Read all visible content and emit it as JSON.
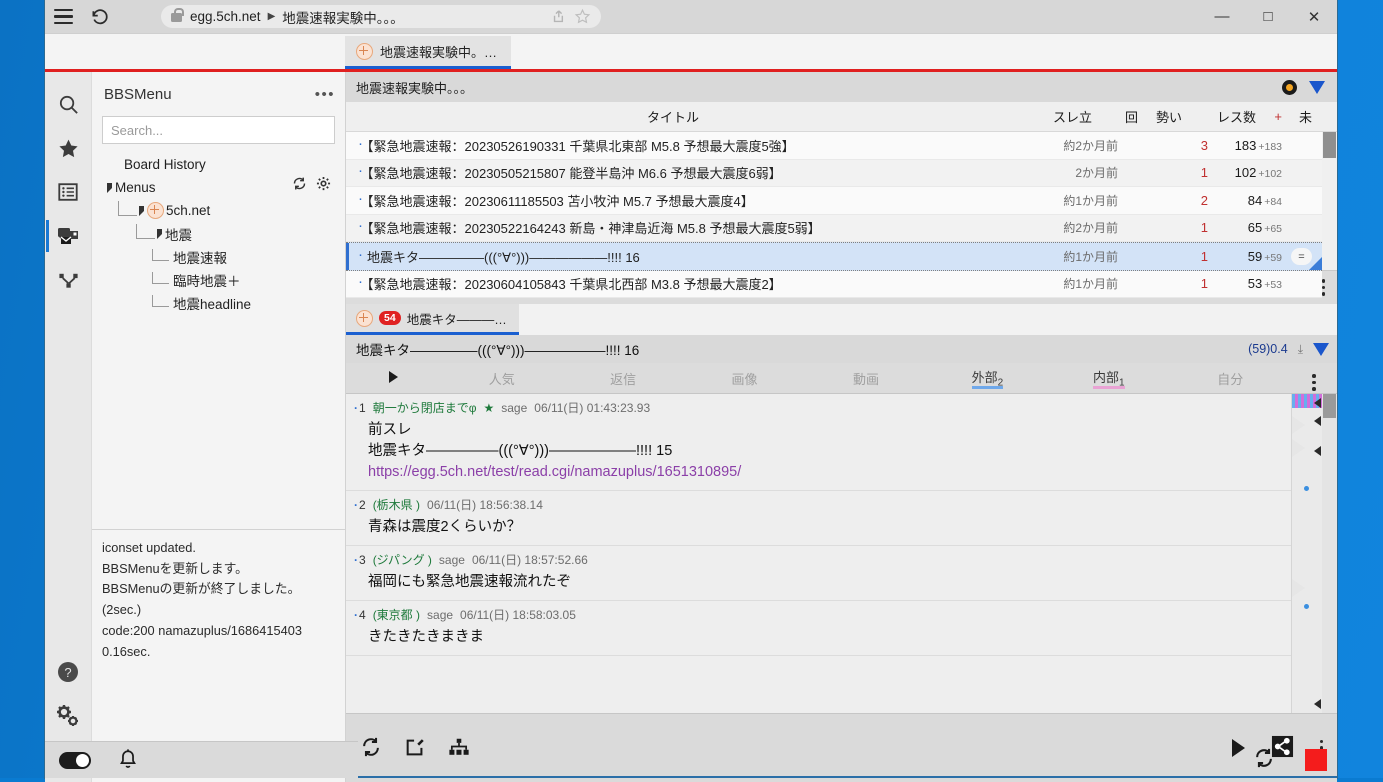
{
  "browser": {
    "url_host": "egg.5ch.net",
    "url_separator": "▶",
    "page_title": "地震速報実験中。。。",
    "minimize": "—",
    "maximize": "□",
    "close": "✕",
    "tab_label": "地震速報実験中。…"
  },
  "rail": {
    "items": [
      {
        "name": "search-icon",
        "label": "Search"
      },
      {
        "name": "favorites-icon",
        "label": "Favorites"
      },
      {
        "name": "board-list-icon",
        "label": "Board list"
      },
      {
        "name": "threads-icon",
        "label": "Threads"
      },
      {
        "name": "share-tree-icon",
        "label": "Tree"
      }
    ],
    "help": "?",
    "settings": "gears"
  },
  "leftpanel": {
    "title": "BBSMenu",
    "menu_dots": "•••",
    "search_placeholder": "Search...",
    "tree": [
      {
        "label": "Board History",
        "depth": 0,
        "kind": "plain"
      },
      {
        "label": "Menus",
        "depth": 0,
        "kind": "expanded"
      },
      {
        "label": "5ch.net",
        "depth": 1,
        "kind": "expanded-icon"
      },
      {
        "label": "地震",
        "depth": 2,
        "kind": "expanded"
      },
      {
        "label": "地震速報",
        "depth": 3,
        "kind": "leaf"
      },
      {
        "label": "臨時地震＋",
        "depth": 3,
        "kind": "leaf"
      },
      {
        "label": "地震headline",
        "depth": 3,
        "kind": "leaf"
      }
    ],
    "log_lines": [
      "iconset updated.",
      "BBSMenuを更新します。",
      "BBSMenuの更新が終了しました。(2sec.)",
      "code:200 namazuplus/1686415403",
      "0.16sec."
    ]
  },
  "board": {
    "header_title": "地震速報実験中。。。",
    "columns": {
      "title": "タイトル",
      "created": "スレ立",
      "count": "回",
      "momentum": "勢い",
      "responses": "レス数",
      "plus": "+",
      "unread": "未"
    },
    "rows": [
      {
        "title": "【緊急地震速報：20230526190331 千葉県北東部 M5.8 予想最大震度5強】",
        "created": "約2か月前",
        "count": "3",
        "responses": "183",
        "plus": "+183",
        "selected": false,
        "badge": ""
      },
      {
        "title": "【緊急地震速報：20230505215807 能登半島沖 M6.6 予想最大震度6弱】",
        "created": "2か月前",
        "count": "1",
        "responses": "102",
        "plus": "+102",
        "selected": false,
        "badge": ""
      },
      {
        "title": "【緊急地震速報：20230611185503 苫小牧沖 M5.7 予想最大震度4】",
        "created": "約1か月前",
        "count": "2",
        "responses": "84",
        "plus": "+84",
        "selected": false,
        "badge": ""
      },
      {
        "title": "【緊急地震速報：20230522164243 新島・神津島近海 M5.8 予想最大震度5弱】",
        "created": "約2か月前",
        "count": "1",
        "responses": "65",
        "plus": "+65",
        "selected": false,
        "badge": ""
      },
      {
        "title": "地震キタ—————(((°∀°)))——————!!!! 16",
        "created": "約1か月前",
        "count": "1",
        "responses": "59",
        "plus": "+59",
        "selected": true,
        "badge": "="
      },
      {
        "title": "【緊急地震速報：20230604105843 千葉県北西部 M3.8 予想最大震度2】",
        "created": "約1か月前",
        "count": "1",
        "responses": "53",
        "plus": "+53",
        "selected": false,
        "badge": ""
      }
    ]
  },
  "thread_toolbar": {
    "reload": "reload-icon",
    "numbering": "numbered-list-icon",
    "sort": "sort-desc-icon",
    "more": "kebab-icon"
  },
  "thread": {
    "tab_badge": "54",
    "tab_label": "地震キタ———…",
    "title": "地震キタ—————(((°∀°)))——————!!!! 16",
    "count_rate": "(59)0.4",
    "filters": [
      {
        "label": "人気",
        "sub": "",
        "active": false,
        "underline": ""
      },
      {
        "label": "返信",
        "sub": "",
        "active": false,
        "underline": ""
      },
      {
        "label": "画像",
        "sub": "",
        "active": false,
        "underline": ""
      },
      {
        "label": "動画",
        "sub": "",
        "active": false,
        "underline": ""
      },
      {
        "label": "外部",
        "sub": "2",
        "active": true,
        "underline": "blue"
      },
      {
        "label": "内部",
        "sub": "1",
        "active": true,
        "underline": "pink"
      },
      {
        "label": "自分",
        "sub": "",
        "active": false,
        "underline": ""
      }
    ],
    "posts": [
      {
        "num": "1",
        "name": "朝一から閉店までφ",
        "star": "★",
        "sage": "sage",
        "time": "06/11(日) 01:43:23.93",
        "lines": [
          "前スレ",
          "地震キタ—————(((°∀°)))——————!!!! 15"
        ],
        "link": "https://egg.5ch.net/test/read.cgi/namazuplus/1651310895/"
      },
      {
        "num": "2",
        "name": "(栃木県 )",
        "star": "",
        "sage": "",
        "time": "06/11(日) 18:56:38.14",
        "lines": [
          "青森は震度2くらいか？"
        ],
        "link": ""
      },
      {
        "num": "3",
        "name": "(ジパング )",
        "star": "",
        "sage": "sage",
        "time": "06/11(日) 18:57:52.66",
        "lines": [
          "福岡にも緊急地震速報流れたぞ"
        ],
        "link": ""
      },
      {
        "num": "4",
        "name": "(東京都 )",
        "star": "",
        "sage": "sage",
        "time": "06/11(日) 18:58:03.05",
        "lines": [
          "きたきたきまきま"
        ],
        "link": ""
      }
    ]
  },
  "bottombar": {
    "reload": "reload-icon",
    "compose": "compose-icon",
    "tree": "sitemap-icon",
    "play": "play-icon",
    "share": "share-icon",
    "more": "kebab-icon",
    "sync": "sync-icon",
    "stop": "stop-icon"
  },
  "statusbar": {
    "toggle": "dark-toggle",
    "bell": "bell-icon"
  },
  "colors": {
    "accent": "#1a5fd0",
    "tab_underline_red": "#e02020",
    "selection": "#d3e3f7",
    "link": "#8b3fa8",
    "name_green": "#1f7a3c",
    "count_red": "#c03030",
    "stop_red": "#f41c1c",
    "desktop": "#0a7bd1"
  }
}
